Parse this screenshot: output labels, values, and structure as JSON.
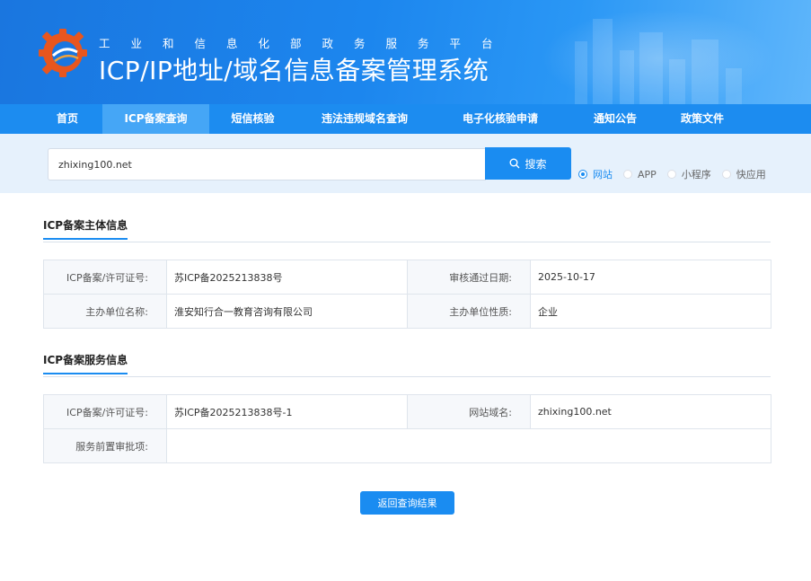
{
  "header": {
    "subtitle": "工业和信息化部政务服务平台",
    "title": "ICP/IP地址/域名信息备案管理系统",
    "logo_icon": "gear-globe-logo"
  },
  "nav": {
    "items": [
      {
        "label": "首页",
        "active": false
      },
      {
        "label": "ICP备案查询",
        "active": true
      },
      {
        "label": "短信核验",
        "active": false
      },
      {
        "label": "违法违规域名查询",
        "active": false
      },
      {
        "label": "电子化核验申请",
        "active": false
      },
      {
        "label": "通知公告",
        "active": false
      },
      {
        "label": "政策文件",
        "active": false
      }
    ]
  },
  "search": {
    "value": "zhixing100.net",
    "button_label": "搜索",
    "button_icon": "search-icon",
    "types": [
      {
        "label": "网站",
        "checked": true
      },
      {
        "label": "APP",
        "checked": false
      },
      {
        "label": "小程序",
        "checked": false
      },
      {
        "label": "快应用",
        "checked": false
      }
    ]
  },
  "entity": {
    "section_title": "ICP备案主体信息",
    "license_label": "ICP备案/许可证号:",
    "license_value": "苏ICP备2025213838号",
    "approve_date_label": "审核通过日期:",
    "approve_date_value": "2025-10-17",
    "org_name_label": "主办单位名称:",
    "org_name_value": "淮安知行合一教育咨询有限公司",
    "org_type_label": "主办单位性质:",
    "org_type_value": "企业"
  },
  "service": {
    "section_title": "ICP备案服务信息",
    "license_label": "ICP备案/许可证号:",
    "license_value": "苏ICP备2025213838号-1",
    "domain_label": "网站域名:",
    "domain_value": "zhixing100.net",
    "pre_approval_label": "服务前置审批项:",
    "pre_approval_value": ""
  },
  "back_button_label": "返回查询结果",
  "colors": {
    "primary": "#1a8cf1",
    "nav_bg": "#1c8cf0",
    "nav_active": "#45a6f6",
    "search_band": "#e6f1fc"
  }
}
